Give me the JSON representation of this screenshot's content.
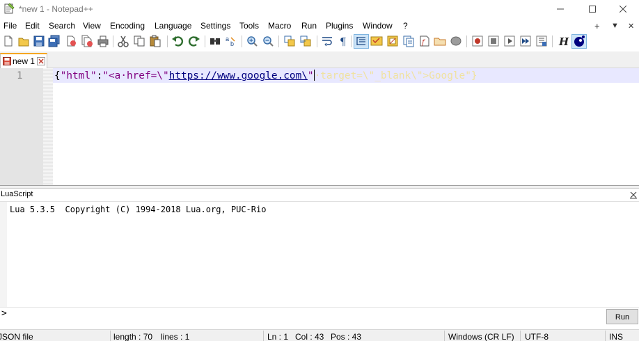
{
  "window": {
    "title": "*new 1 - Notepad++"
  },
  "menu": {
    "items": [
      "File",
      "Edit",
      "Search",
      "View",
      "Encoding",
      "Language",
      "Settings",
      "Tools",
      "Macro",
      "Run",
      "Plugins",
      "Window",
      "?"
    ],
    "right_items": [
      "+",
      "▼",
      "✕"
    ]
  },
  "toolbar": {
    "icons": [
      "new-file-icon",
      "open-file-icon",
      "save-icon",
      "save-all-icon",
      "close-icon",
      "close-all-icon",
      "print-icon",
      "cut-icon",
      "copy-icon",
      "paste-icon",
      "undo-icon",
      "redo-icon",
      "find-icon",
      "replace-icon",
      "zoom-in-icon",
      "zoom-out-icon",
      "sync-vertical-icon",
      "sync-horizontal-icon",
      "word-wrap-icon",
      "show-all-chars-icon",
      "indent-guide-icon",
      "udl-icon",
      "doc-map-icon",
      "doc-list-icon",
      "function-list-icon",
      "folder-workspace-icon",
      "monitoring-icon",
      "record-macro-icon",
      "stop-record-icon",
      "playback-macro-icon",
      "run-macro-multiple-icon",
      "save-macro-icon",
      "html-tag-icon",
      "lua-icon"
    ]
  },
  "tabs": [
    {
      "label": "new 1",
      "modified": true
    }
  ],
  "editor": {
    "line_number": "1",
    "code": {
      "brace_open": "{",
      "key": "\"html\"",
      "colon": ":",
      "str_start": "\"<a·href=\\\"",
      "url": "https://www.google.com\\",
      "str_end": "\"",
      "faint_tail": "·target=\\\"_blank\\\">Google\"}"
    }
  },
  "lua_panel": {
    "title": "LuaScript",
    "output": "Lua 5.3.5  Copyright (C) 1994-2018 Lua.org, PUC-Rio",
    "prompt": ">",
    "run_label": "Run"
  },
  "status": {
    "file_type": "JSON file",
    "length": "length : 70",
    "lines": "lines : 1",
    "ln": "Ln : 1",
    "col": "Col : 43",
    "pos": "Pos : 43",
    "eol": "Windows (CR LF)",
    "encoding": "UTF-8",
    "mode": "INS"
  },
  "colors": {
    "keyword_string": "#800080",
    "url": "#00007f",
    "current_line": "#e8e8ff",
    "active_tab_accent": "#f5a622"
  }
}
